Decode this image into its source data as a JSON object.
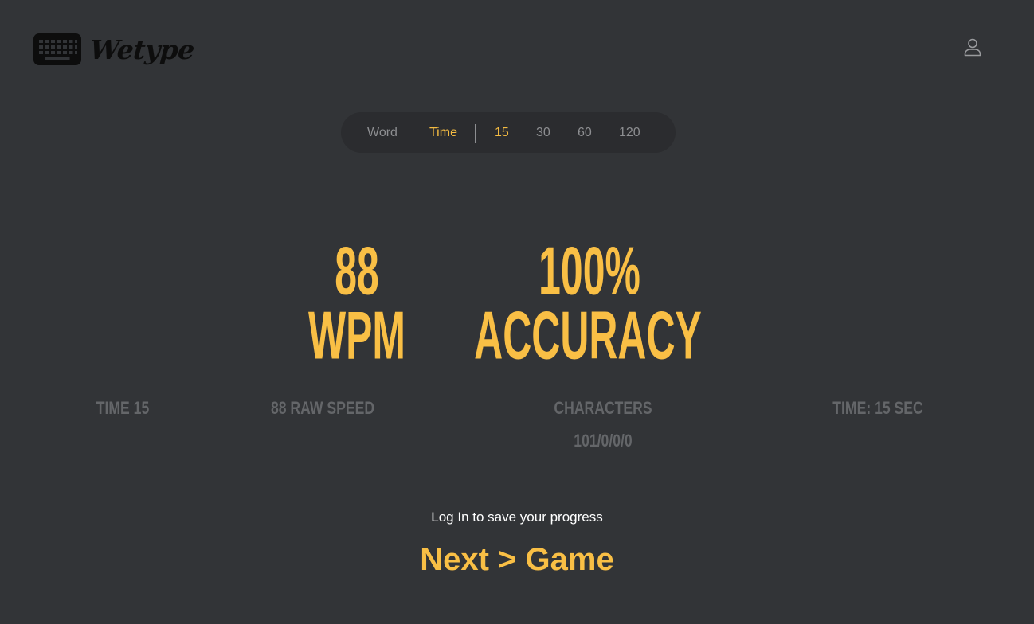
{
  "header": {
    "logo_text": "Wetype",
    "logo_icon": "keyboard-icon",
    "user_icon": "user-icon"
  },
  "mode_bar": {
    "modes": [
      "Word",
      "Time"
    ],
    "active_mode": "Time",
    "durations": [
      "15",
      "30",
      "60",
      "120"
    ],
    "active_duration": "15"
  },
  "results": {
    "wpm_value": "88",
    "wpm_label": "WPM",
    "accuracy_value": "100%",
    "accuracy_label": "ACCURACY",
    "test_type": "TIME 15",
    "raw_speed": "88 RAW SPEED",
    "characters_label": "CHARACTERS",
    "characters_value": "101/0/0/0",
    "time": "TIME: 15 SEC"
  },
  "footer": {
    "login_link": "Log In",
    "login_rest": " to save your progress",
    "next_game": "Next > Game"
  },
  "colors": {
    "background": "#323437",
    "accent": "#f9bf45",
    "muted": "#646669",
    "mode_bar_bg": "#2b2c2f"
  }
}
